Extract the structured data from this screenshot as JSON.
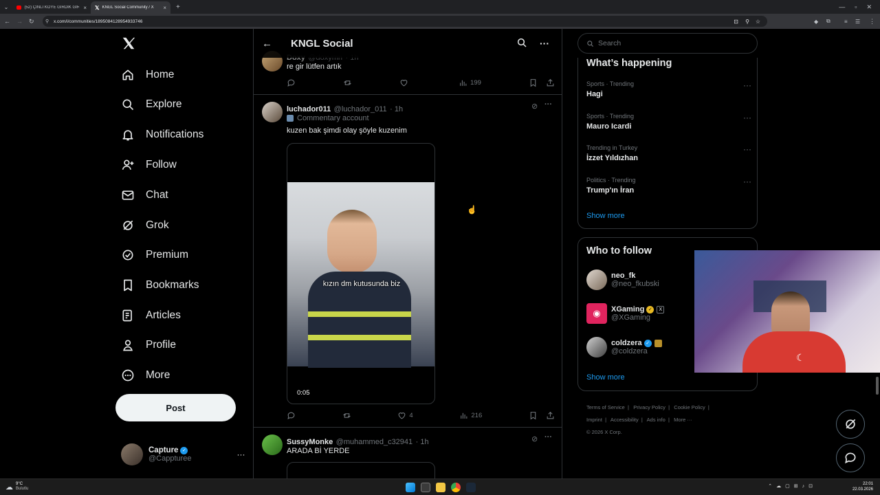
{
  "browser": {
    "tabs": [
      {
        "label": "(52) ÇİNLİ KÖYE GİRDİK GİRME",
        "active": false
      },
      {
        "label": "KNGL Social Community / X",
        "active": true
      }
    ],
    "url": "x.com/i/communities/1895084128954933746"
  },
  "nav": {
    "items": [
      {
        "label": "Home",
        "icon": "home-icon"
      },
      {
        "label": "Explore",
        "icon": "search-icon"
      },
      {
        "label": "Notifications",
        "icon": "bell-icon"
      },
      {
        "label": "Follow",
        "icon": "follow-icon"
      },
      {
        "label": "Chat",
        "icon": "mail-icon"
      },
      {
        "label": "Grok",
        "icon": "grok-icon"
      },
      {
        "label": "Premium",
        "icon": "premium-icon"
      },
      {
        "label": "Bookmarks",
        "icon": "bookmark-icon"
      },
      {
        "label": "Articles",
        "icon": "articles-icon"
      },
      {
        "label": "Profile",
        "icon": "profile-icon"
      },
      {
        "label": "More",
        "icon": "more-icon"
      }
    ],
    "post_label": "Post",
    "account": {
      "name": "Capture",
      "handle": "@Cappturee"
    }
  },
  "header": {
    "title": "KNGL Social"
  },
  "posts": [
    {
      "author": "Doxy",
      "handle": "@doxymn",
      "time": "1h",
      "text": "re gir lütfen artık",
      "views": "199",
      "likes": ""
    },
    {
      "author": "luchador011",
      "handle": "@luchador_011",
      "time": "1h",
      "badge": "Commentary account",
      "text": "kuzen bak şimdi olay şöyle kuzenim",
      "video_caption": "kızın dm kutusunda biz",
      "video_time": "0:05",
      "views": "216",
      "likes": "4"
    },
    {
      "author": "SussyMonke",
      "handle": "@muhammed_c32941",
      "time": "1h",
      "text": "ARADA Bİ YERDE"
    }
  ],
  "sidebar": {
    "search_placeholder": "Search",
    "happening_title": "What’s happening",
    "trends": [
      {
        "meta": "Sports · Trending",
        "name": "Hagi"
      },
      {
        "meta": "Sports · Trending",
        "name": "Mauro Icardi"
      },
      {
        "meta": "Trending in Turkey",
        "name": "İzzet Yıldızhan"
      },
      {
        "meta": "Politics · Trending",
        "name": "Trump'ın İran"
      }
    ],
    "show_more": "Show more",
    "follow_title": "Who to follow",
    "follows": [
      {
        "name": "neo_fk",
        "handle": "@neo_fkubski"
      },
      {
        "name": "XGaming",
        "handle": "@XGaming"
      },
      {
        "name": "coldzera",
        "handle": "@coldzera"
      }
    ],
    "footer_links": [
      "Terms of Service",
      "Privacy Policy",
      "Cookie Policy",
      "Imprint",
      "Accessibility",
      "Ads info",
      "More ···"
    ],
    "copyright": "© 2026 X Corp."
  },
  "taskbar": {
    "weather_temp": "9°C",
    "weather_desc": "Bulutlu",
    "time": "22:01",
    "date": "22.03.2026"
  },
  "colors": {
    "accent": "#1d9bf0",
    "background": "#000000",
    "border": "#2f3336",
    "muted": "#71767b"
  }
}
